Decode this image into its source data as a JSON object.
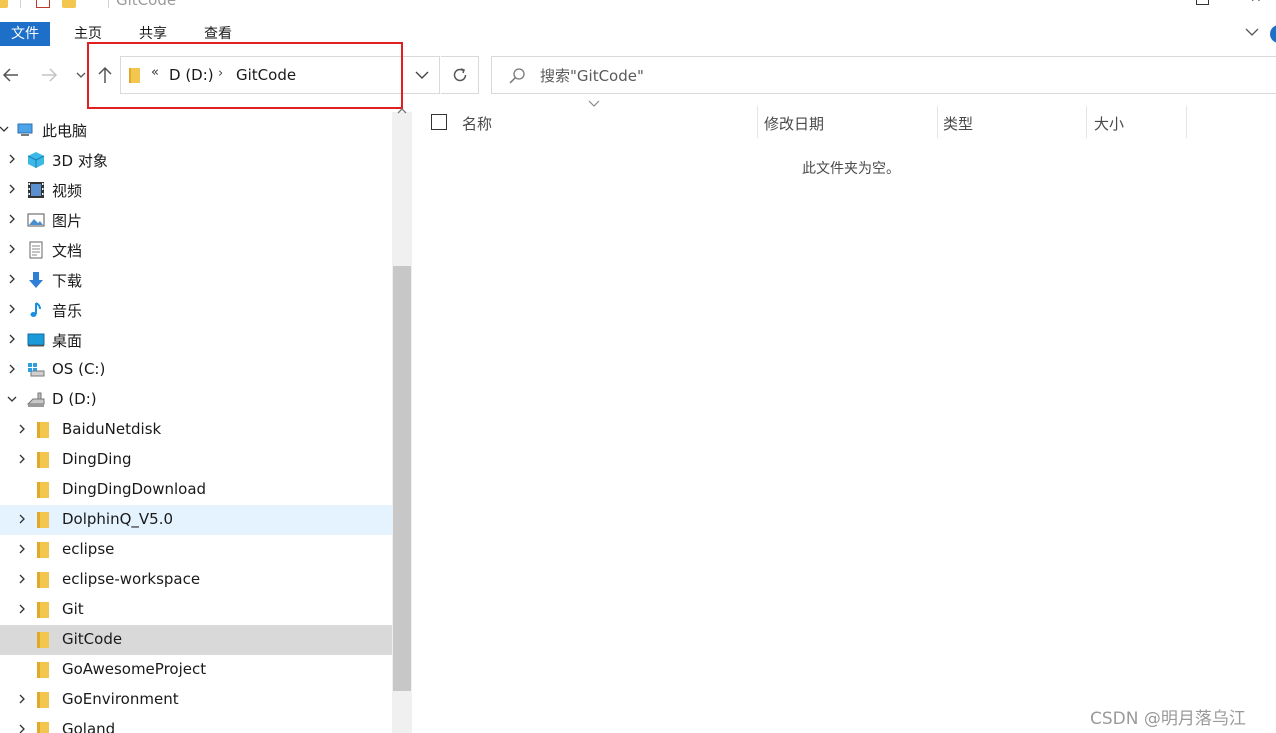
{
  "window": {
    "title": "GitCode"
  },
  "ribbon": {
    "tabs": [
      {
        "label": "文件"
      },
      {
        "label": "主页"
      },
      {
        "label": "共享"
      },
      {
        "label": "查看"
      }
    ]
  },
  "address_bar": {
    "overflow": "«",
    "crumbs": [
      "D (D:)",
      "GitCode"
    ],
    "separator": "›"
  },
  "search": {
    "placeholder": "搜索\"GitCode\""
  },
  "sidebar": {
    "items": [
      {
        "label": "此电脑",
        "icon": "computer-icon",
        "level": 0,
        "expanded": true
      },
      {
        "label": "3D 对象",
        "icon": "3d-objects-icon",
        "level": 1
      },
      {
        "label": "视频",
        "icon": "videos-icon",
        "level": 1
      },
      {
        "label": "图片",
        "icon": "pictures-icon",
        "level": 1
      },
      {
        "label": "文档",
        "icon": "documents-icon",
        "level": 1
      },
      {
        "label": "下载",
        "icon": "downloads-icon",
        "level": 1
      },
      {
        "label": "音乐",
        "icon": "music-icon",
        "level": 1
      },
      {
        "label": "桌面",
        "icon": "desktop-icon",
        "level": 1
      },
      {
        "label": "OS (C:)",
        "icon": "drive-c-icon",
        "level": 1
      },
      {
        "label": "D (D:)",
        "icon": "drive-d-icon",
        "level": 1,
        "expanded": true
      },
      {
        "label": "BaiduNetdisk",
        "icon": "folder-icon",
        "level": 2
      },
      {
        "label": "DingDing",
        "icon": "folder-icon",
        "level": 2
      },
      {
        "label": "DingDingDownload",
        "icon": "folder-icon",
        "level": 2
      },
      {
        "label": "DolphinQ_V5.0",
        "icon": "folder-icon",
        "level": 2,
        "state": "hover"
      },
      {
        "label": "eclipse",
        "icon": "folder-icon",
        "level": 2
      },
      {
        "label": "eclipse-workspace",
        "icon": "folder-icon",
        "level": 2
      },
      {
        "label": "Git",
        "icon": "folder-icon",
        "level": 2
      },
      {
        "label": "GitCode",
        "icon": "folder-icon",
        "level": 2,
        "state": "selected"
      },
      {
        "label": "GoAwesomeProject",
        "icon": "folder-icon",
        "level": 2
      },
      {
        "label": "GoEnvironment",
        "icon": "folder-icon",
        "level": 2
      },
      {
        "label": "Goland",
        "icon": "folder-icon",
        "level": 2
      }
    ]
  },
  "columns": {
    "name": "名称",
    "date_modified": "修改日期",
    "type": "类型",
    "size": "大小"
  },
  "content": {
    "empty_message": "此文件夹为空。"
  },
  "watermark": "CSDN @明月落乌江",
  "colors": {
    "accent": "#1e6fc8",
    "folder": "#f3c650",
    "highlight_box": "#e02020",
    "selected_row": "#d9d9d9",
    "hover_row": "#e5f3ff"
  }
}
